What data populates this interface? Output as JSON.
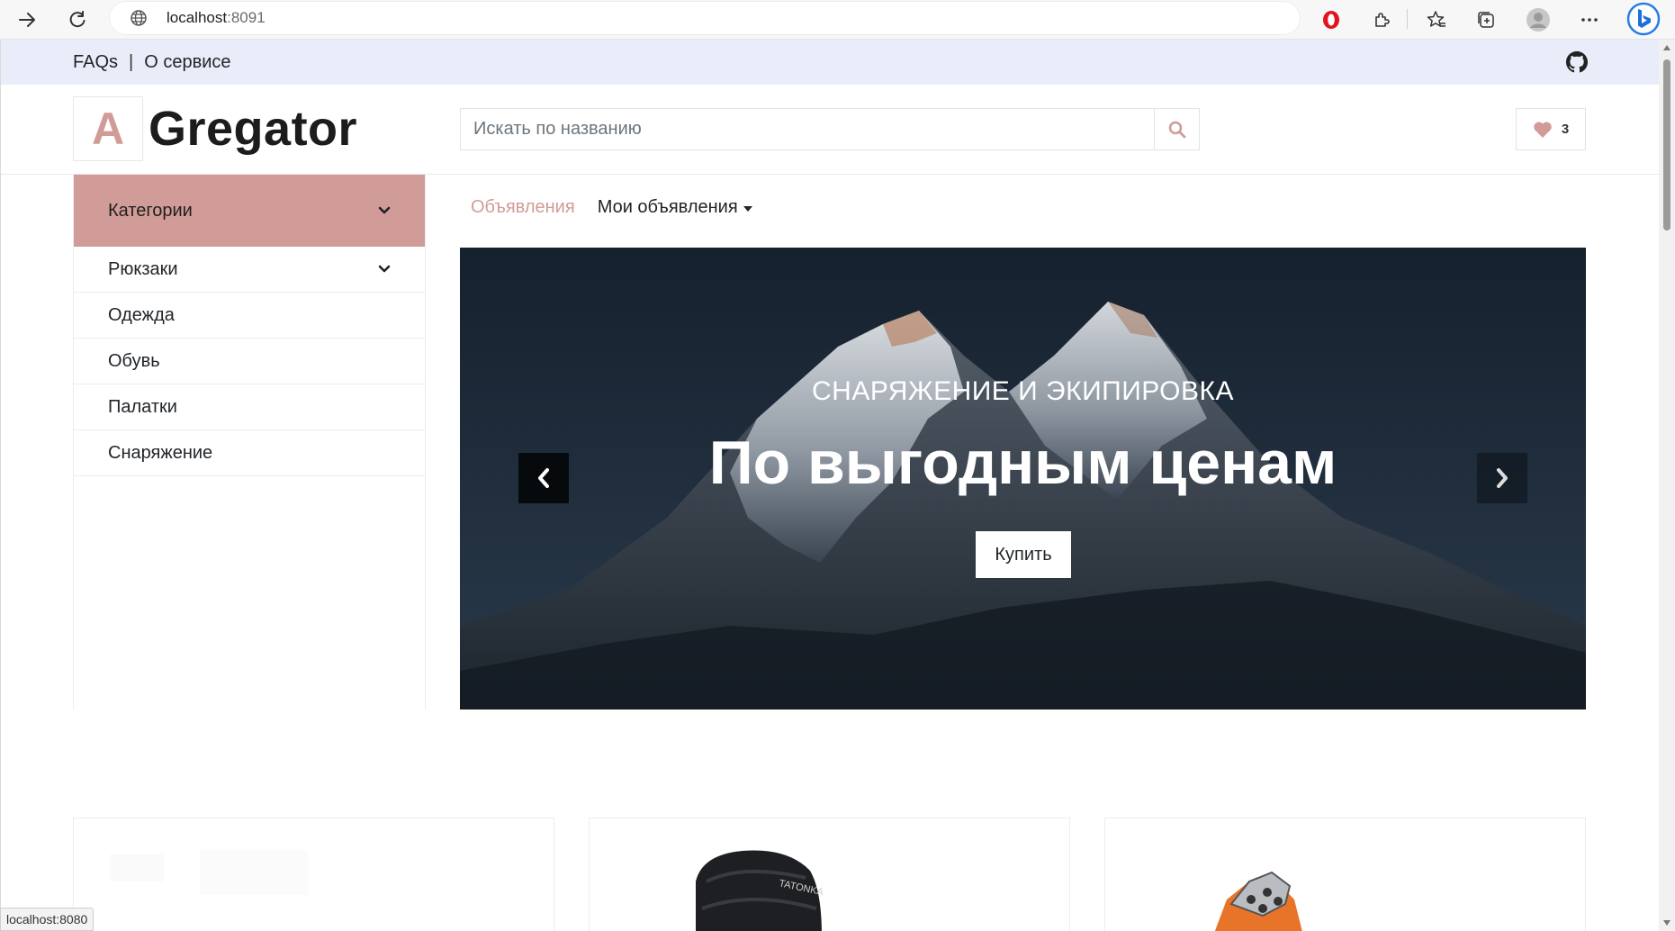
{
  "browser": {
    "url_host": "localhost",
    "url_port": ":8091",
    "status_url": "localhost:8080"
  },
  "topbar": {
    "links": [
      "FAQs",
      "О сервисе"
    ],
    "divider": "|"
  },
  "header": {
    "logo_letter": "A",
    "logo_text": "Gregator",
    "search_placeholder": "Искать по названию",
    "favorites_count": "3"
  },
  "sidebar": {
    "title": "Категории",
    "items": [
      {
        "label": "Рюкзаки",
        "has_submenu": true
      },
      {
        "label": "Одежда"
      },
      {
        "label": "Обувь"
      },
      {
        "label": "Палатки"
      },
      {
        "label": "Снаряжение"
      }
    ]
  },
  "nav": {
    "active_tab": "Объявления",
    "dropdown_tab": "Мои объявления"
  },
  "hero": {
    "subtitle": "СНАРЯЖЕНИЕ И ЭКИПИРОВКА",
    "title": "По выгодным ценам",
    "button": "Купить"
  },
  "colors": {
    "accent": "#d19c97",
    "topbar_bg": "#e9edf9"
  },
  "icons": [
    "back-arrow-icon",
    "reload-icon",
    "globe-icon",
    "opera-icon",
    "extensions-icon",
    "favorites-icon",
    "collections-icon",
    "profile-icon",
    "more-icon",
    "bing-icon",
    "github-icon",
    "search-icon",
    "heart-icon",
    "chevron-down-icon",
    "chevron-left-icon",
    "chevron-right-icon"
  ]
}
